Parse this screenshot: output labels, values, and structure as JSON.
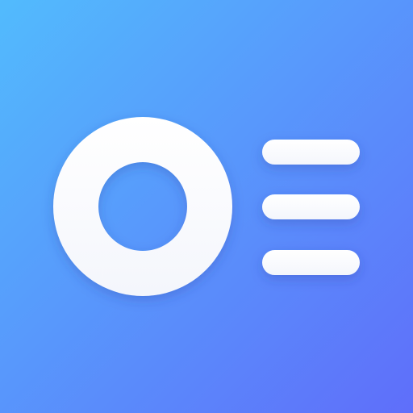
{
  "app_icon": {
    "semantic": "ring-and-list-icon",
    "colors": {
      "gradient_start": "#52BBFD",
      "gradient_end": "#5F6EFA",
      "glyph": "#FFFFFF",
      "glyph_shade": "#F4F6FC"
    },
    "list_lines": 3
  }
}
